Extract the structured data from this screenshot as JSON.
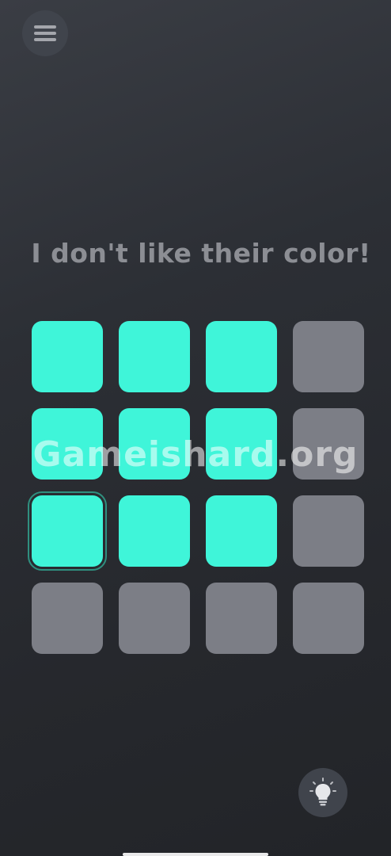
{
  "header": {
    "menu_icon": "hamburger-menu-icon"
  },
  "level": {
    "prompt": "I don't like their color!"
  },
  "colors": {
    "tile_on": "#3ff5d9",
    "tile_off": "#7c7e86",
    "background": "#2c2f35"
  },
  "grid": {
    "rows": 4,
    "cols": 4,
    "tiles": [
      [
        "on",
        "on",
        "on",
        "off"
      ],
      [
        "on",
        "on",
        "on",
        "off"
      ],
      [
        "on",
        "on",
        "on",
        "off"
      ],
      [
        "off",
        "off",
        "off",
        "off"
      ]
    ],
    "selected": [
      2,
      0
    ]
  },
  "watermark": {
    "text": "Gameishard.org"
  },
  "footer": {
    "hint_icon": "lightbulb-icon"
  }
}
